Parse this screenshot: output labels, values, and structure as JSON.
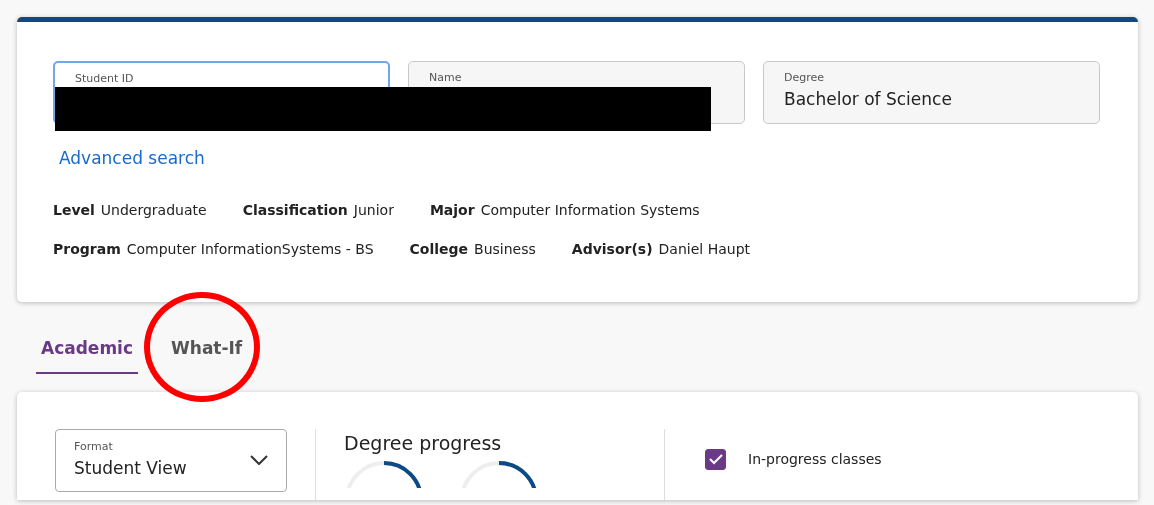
{
  "student": {
    "fields": [
      {
        "label": "Student ID",
        "focused": true
      },
      {
        "label": "Name",
        "focused": false
      },
      {
        "label": "Degree",
        "value": "Bachelor of Science",
        "focused": false
      }
    ],
    "advanced_search": "Advanced search",
    "info_rows": [
      [
        {
          "label": "Level",
          "value": "Undergraduate"
        },
        {
          "label": "Classification",
          "value": "Junior"
        },
        {
          "label": "Major",
          "value": "Computer Information Systems"
        }
      ],
      [
        {
          "label": "Program",
          "value": "Computer InformationSystems - BS"
        },
        {
          "label": "College",
          "value": "Business"
        },
        {
          "label": "Advisor(s)",
          "value": "Daniel Haupt"
        }
      ]
    ]
  },
  "tabs": [
    {
      "label": "Academic",
      "selected": true
    },
    {
      "label": "What-If",
      "selected": false,
      "circled": true
    }
  ],
  "audit": {
    "format": {
      "label": "Format",
      "value": "Student View"
    },
    "progress_title": "Degree progress",
    "options": [
      {
        "label": "In-progress classes",
        "checked": true
      }
    ]
  },
  "redaction": true
}
